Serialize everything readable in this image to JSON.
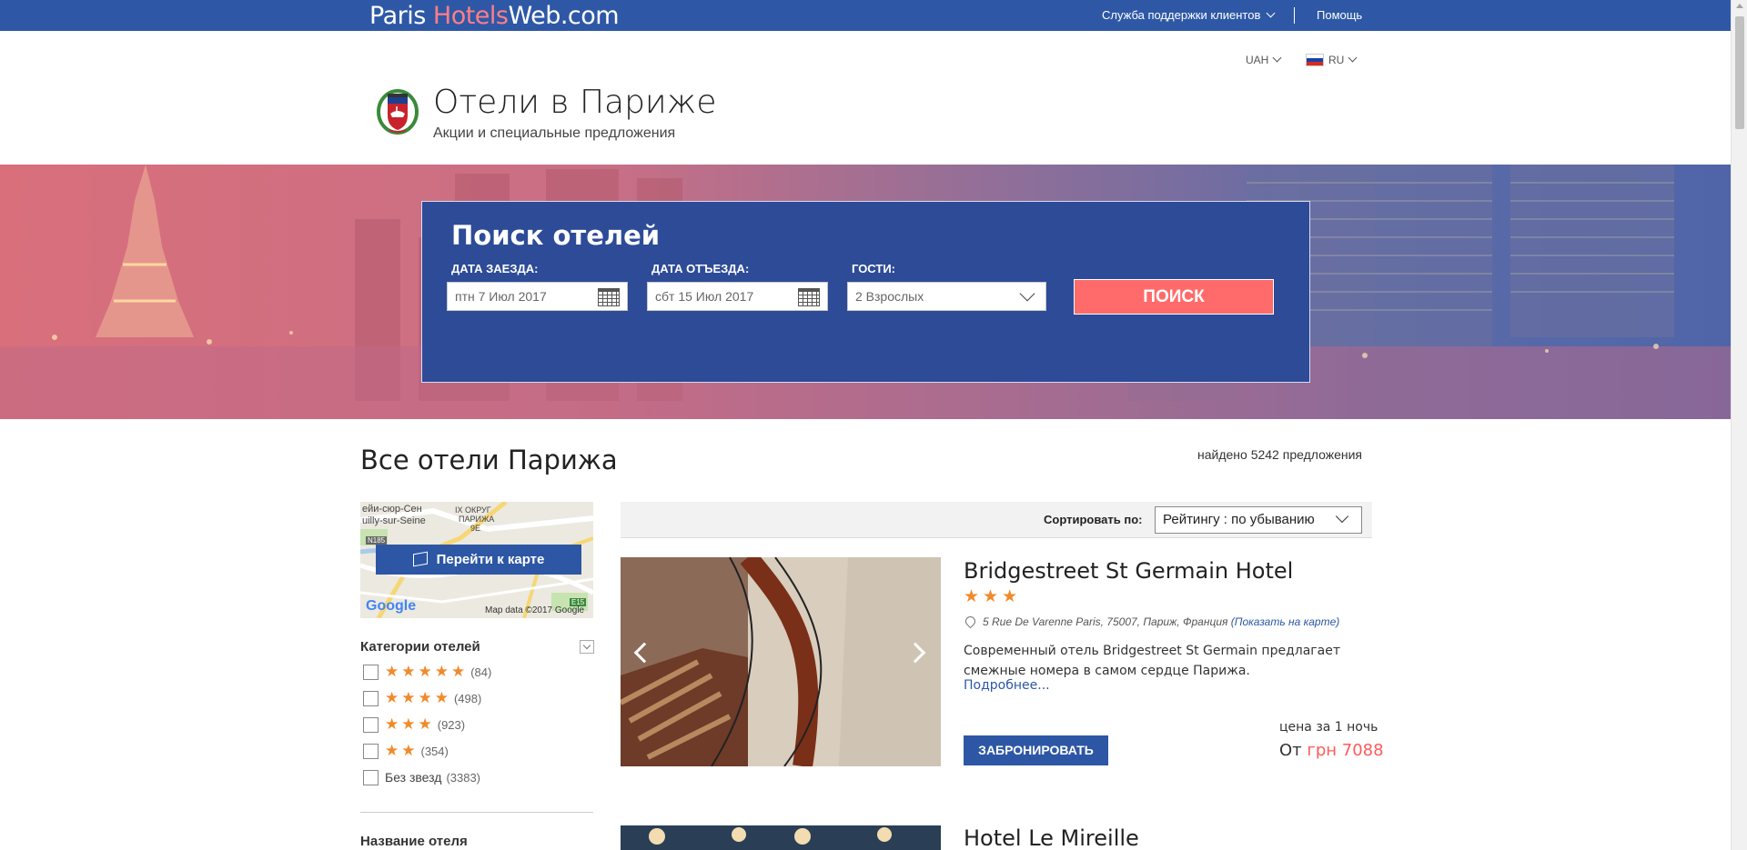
{
  "topbar": {
    "brand_a": "Paris",
    "brand_b": "Hotels",
    "brand_c": "Web.com",
    "support": "Служба поддержки клиентов",
    "help": "Помощь"
  },
  "header": {
    "currency": "UAH",
    "language": "RU",
    "title": "Отели в Париже",
    "subtitle": "Акции и специальные предложения"
  },
  "search": {
    "title": "Поиск отелей",
    "checkin_label": "ДАТА ЗАЕЗДА:",
    "checkin_value": "птн 7 Июл 2017",
    "checkout_label": "ДАТА ОТЪЕЗДА:",
    "checkout_value": "сбт 15 Июл 2017",
    "guests_label": "ГОСТИ:",
    "guests_value": "2 Взрослых",
    "button": "ПОИСК"
  },
  "results": {
    "heading": "Все отели Парижа",
    "found": "найдено 5242 предложения"
  },
  "sidebar": {
    "map_button": "Перейти к карте",
    "map_labels": [
      "ейи-сюр-Сен",
      "uilly-sur-Seine",
      "IX ОКРУГ",
      "ПАРИЖА",
      "9E",
      "N185",
      "E15"
    ],
    "map_google": "Google",
    "map_data": "Map data ©2017 Google",
    "categories_heading": "Категории отелей",
    "categories": [
      {
        "stars": "★★★★★",
        "count": "(84)"
      },
      {
        "stars": "★★★★",
        "count": "(498)"
      },
      {
        "stars": "★★★",
        "count": "(923)"
      },
      {
        "stars": "★★",
        "count": "(354)"
      },
      {
        "label": "Без звезд",
        "count": "(3383)"
      }
    ],
    "name_heading": "Название отеля"
  },
  "sort": {
    "label": "Сортировать по:",
    "value": "Рейтингу : по убыванию"
  },
  "hotels": [
    {
      "name": "Bridgestreet St Germain Hotel",
      "stars": "★★★",
      "address": "5 Rue De Varenne Paris, 75007, Париж, Франция",
      "map_link": "(Показать на карте)",
      "description": "Современный отель Bridgestreet St Germain предлагает смежные номера в самом сердце Парижа.",
      "more": "Подробнее...",
      "book": "ЗАБРОНИРОВАТЬ",
      "price_label": "цена за 1 ночь",
      "price_prefix": "От",
      "price": "грн 7088"
    },
    {
      "name": "Hotel Le Mireille"
    }
  ],
  "colors": {
    "brand_blue": "#2e58a6",
    "search_bg": "#2d4b97",
    "accent_red": "#ff6b6b",
    "star_orange": "#f08a2b"
  }
}
